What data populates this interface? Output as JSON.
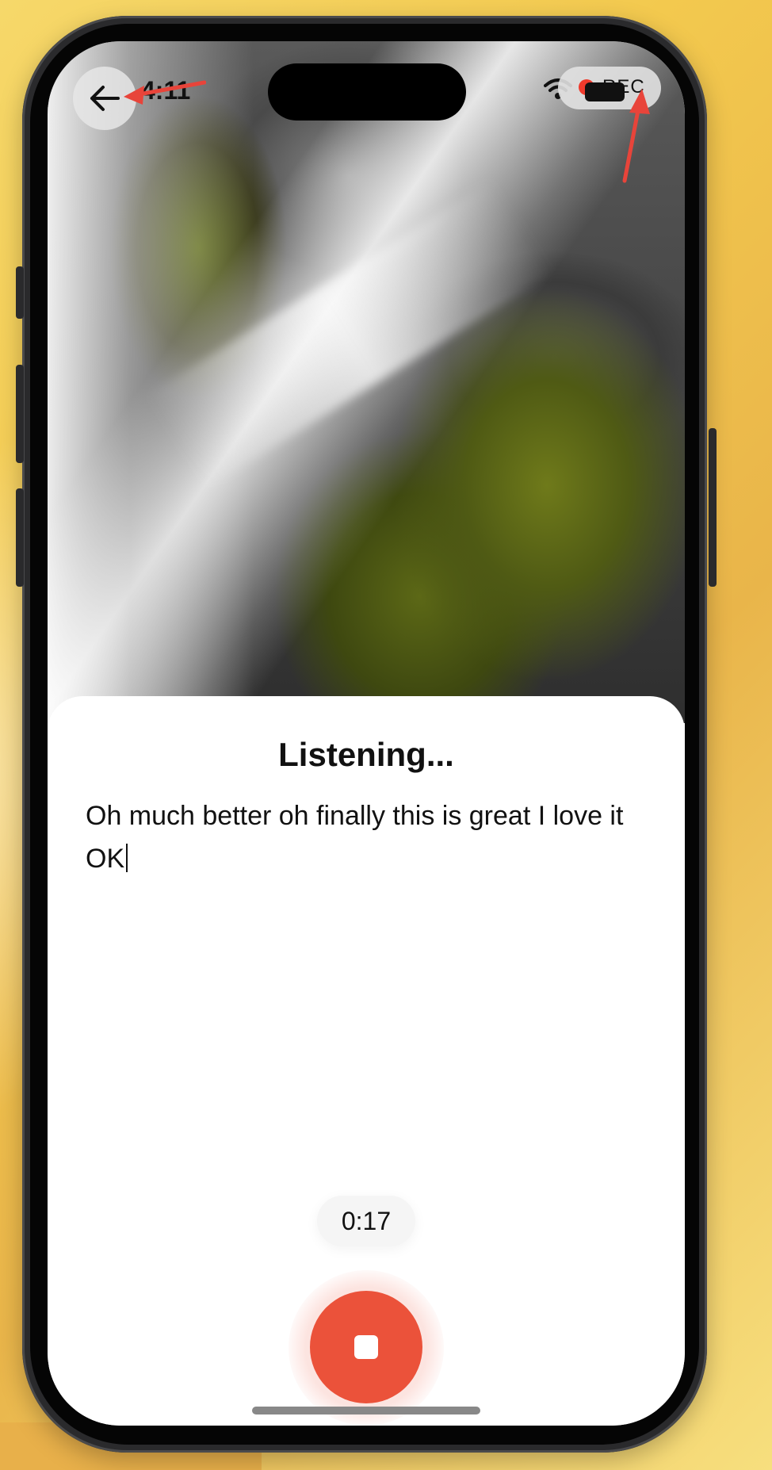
{
  "status_bar": {
    "time": "4:11",
    "rec_label": "REC"
  },
  "icons": {
    "back": "arrow-left-icon",
    "wifi": "wifi-icon",
    "battery": "battery-icon",
    "stop": "stop-icon",
    "rec": "recording-dot-icon"
  },
  "sheet": {
    "title": "Listening...",
    "transcript": "Oh much better oh finally this is great I love it OK"
  },
  "timer": {
    "elapsed": "0:17"
  },
  "colors": {
    "record_red": "#eb523a",
    "annotation_red": "#e8443a"
  }
}
